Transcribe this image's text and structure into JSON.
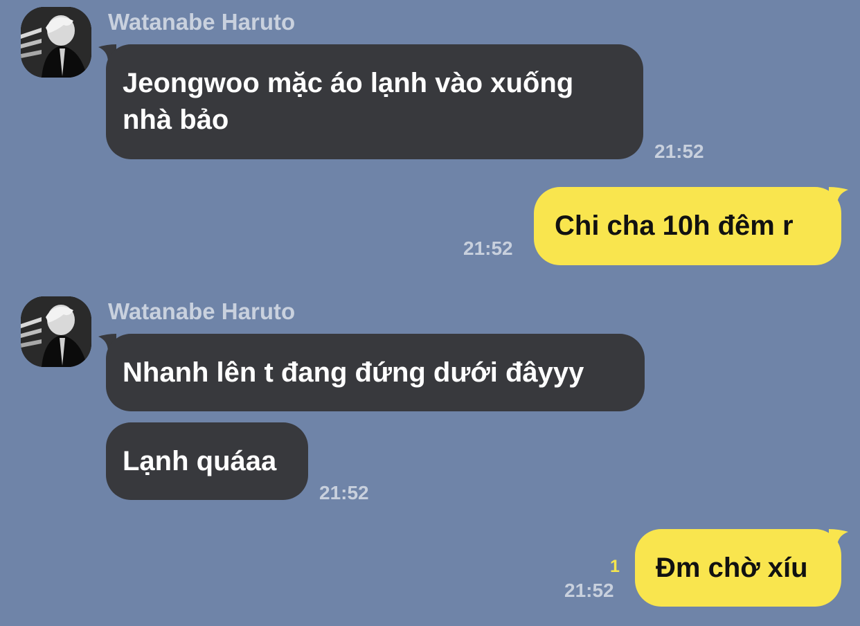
{
  "chat": {
    "colors": {
      "background": "#6f84a8",
      "incoming_bubble": "#38393d",
      "outgoing_bubble": "#f9e54e",
      "timestamp": "#c8d0dd",
      "sender_name": "#c9d1de",
      "unread_count": "#f5e64e"
    },
    "messages": [
      {
        "direction": "incoming",
        "sender": "Watanabe Haruto",
        "lines": [
          "Jeongwoo mặc áo lạnh vào xuống",
          "nhà bảo"
        ],
        "time": "21:52"
      },
      {
        "direction": "outgoing",
        "text": "Chi cha 10h đêm r",
        "time": "21:52"
      },
      {
        "direction": "incoming",
        "sender": "Watanabe Haruto",
        "text": "Nhanh lên t đang đứng dưới đâyyy"
      },
      {
        "direction": "incoming",
        "text": "Lạnh quáaa",
        "time": "21:52"
      },
      {
        "direction": "outgoing",
        "text": "Đm chờ xíu",
        "unread": "1",
        "time": "21:52"
      }
    ]
  }
}
